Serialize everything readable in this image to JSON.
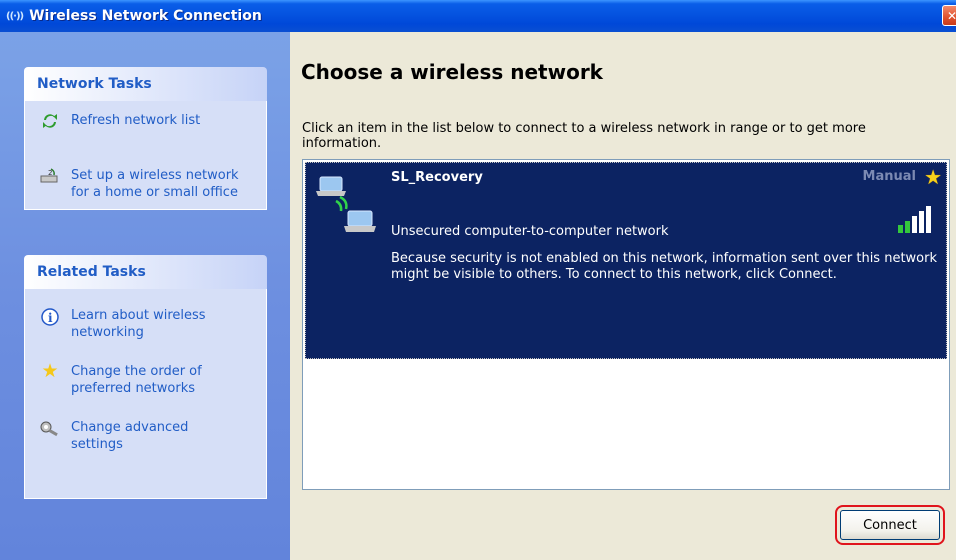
{
  "window": {
    "title": "Wireless Network Connection",
    "title_icon": "wireless-antenna-icon",
    "close_icon": "close-icon"
  },
  "sidebar": {
    "network_tasks": {
      "header": "Network Tasks",
      "items": [
        {
          "label": "Refresh network list",
          "icon": "refresh-icon"
        },
        {
          "label": "Set up a wireless network\nfor a home or small office",
          "icon": "setup-wizard-icon"
        }
      ]
    },
    "related_tasks": {
      "header": "Related Tasks",
      "items": [
        {
          "label": "Learn about wireless\nnetworking",
          "icon": "info-icon"
        },
        {
          "label": "Change the order of\npreferred networks",
          "icon": "star-icon"
        },
        {
          "label": "Change advanced\nsettings",
          "icon": "settings-icon"
        }
      ]
    }
  },
  "main": {
    "heading": "Choose a wireless network",
    "description": "Click an item in the list below to connect to a wireless network in range or to get more information.",
    "networks": [
      {
        "ssid": "SL_Recovery",
        "mode": "Manual",
        "security": "Unsecured computer-to-computer network",
        "signal_bars": 5,
        "details": "Because security is not enabled on this network, information sent over this network might be visible to others. To connect to this network, click Connect.",
        "selected": true
      }
    ],
    "connect_label": "Connect"
  },
  "colors": {
    "titlebar": "#0553e0",
    "taskpane": "#6d8fe0",
    "selection": "#0c2362",
    "highlight_outline": "#e0141c"
  }
}
